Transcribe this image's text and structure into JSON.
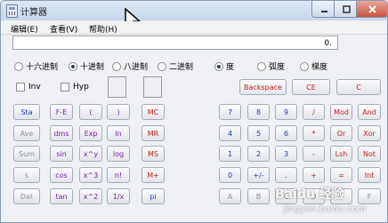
{
  "window": {
    "title": "计算器"
  },
  "menu": [
    "编辑(E)",
    "查看(V)",
    "帮助(H)"
  ],
  "display": {
    "value": "0."
  },
  "number_base": {
    "options": [
      "十六进制",
      "十进制",
      "八进制",
      "二进制"
    ],
    "selected": "十进制"
  },
  "angle_unit": {
    "options": [
      "度",
      "弧度",
      "梯度"
    ],
    "selected": "度"
  },
  "checkboxes": [
    "Inv",
    "Hyp"
  ],
  "clear_buttons": [
    "Backspace",
    "CE",
    "C"
  ],
  "function_rows": [
    [
      "Sta",
      "F-E",
      "(",
      ")"
    ],
    [
      "Ave",
      "dms",
      "Exp",
      "ln"
    ],
    [
      "Sum",
      "sin",
      "x^y",
      "log"
    ],
    [
      "s",
      "cos",
      "x^3",
      "n!"
    ],
    [
      "Dat",
      "tan",
      "x^2",
      "1/x"
    ]
  ],
  "memory_buttons": [
    "MC",
    "MR",
    "MS",
    "M+",
    "pi"
  ],
  "keypad_rows": [
    [
      "7",
      "8",
      "9",
      "/",
      "Mod",
      "And"
    ],
    [
      "4",
      "5",
      "6",
      "*",
      "Or",
      "Xor"
    ],
    [
      "1",
      "2",
      "3",
      "-",
      "Lsh",
      "Not"
    ],
    [
      "0",
      "+/-",
      ".",
      "+",
      "=",
      "Int"
    ],
    [
      "A",
      "B",
      "C",
      "D",
      "E",
      "F"
    ]
  ],
  "watermark": {
    "logo": "Baidu 经验",
    "url": "jingyan.baidu.com"
  }
}
